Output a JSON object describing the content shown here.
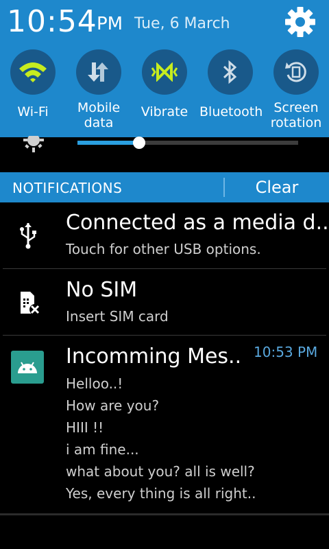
{
  "status": {
    "time": "10:54",
    "ampm": "PM",
    "date": "Tue, 6 March"
  },
  "quick_settings": [
    {
      "label": "Wi-Fi",
      "icon": "wifi-icon"
    },
    {
      "label": "Mobile data",
      "icon": "mobile-data-icon"
    },
    {
      "label": "Vibrate",
      "icon": "vibrate-icon"
    },
    {
      "label": "Bluetooth",
      "icon": "bluetooth-icon"
    },
    {
      "label": "Screen rotation",
      "icon": "screen-rotation-icon"
    }
  ],
  "brightness": {
    "level": 0.28
  },
  "notifications_bar": {
    "title": "NOTIFICATIONS",
    "clear_label": "Clear"
  },
  "notifications": [
    {
      "title": "Connected as a media d..",
      "subtitle": "Touch for other USB options.",
      "icon": "usb-icon"
    },
    {
      "title": "No SIM",
      "subtitle": "Insert SIM card",
      "icon": "no-sim-icon"
    },
    {
      "title": "Incomming Mes..",
      "time": "10:53 PM",
      "icon": "android-app-icon",
      "lines": [
        "Helloo..!",
        "How are you?",
        "HIII !!",
        "i am fine...",
        "what about you? all is well?",
        "Yes, every thing is all right.."
      ]
    }
  ],
  "colors": {
    "header_blue": "#1e88cc",
    "toggle_circle": "#19598a",
    "active_toggle": "#c6ec1f",
    "time_accent": "#59a8de"
  }
}
